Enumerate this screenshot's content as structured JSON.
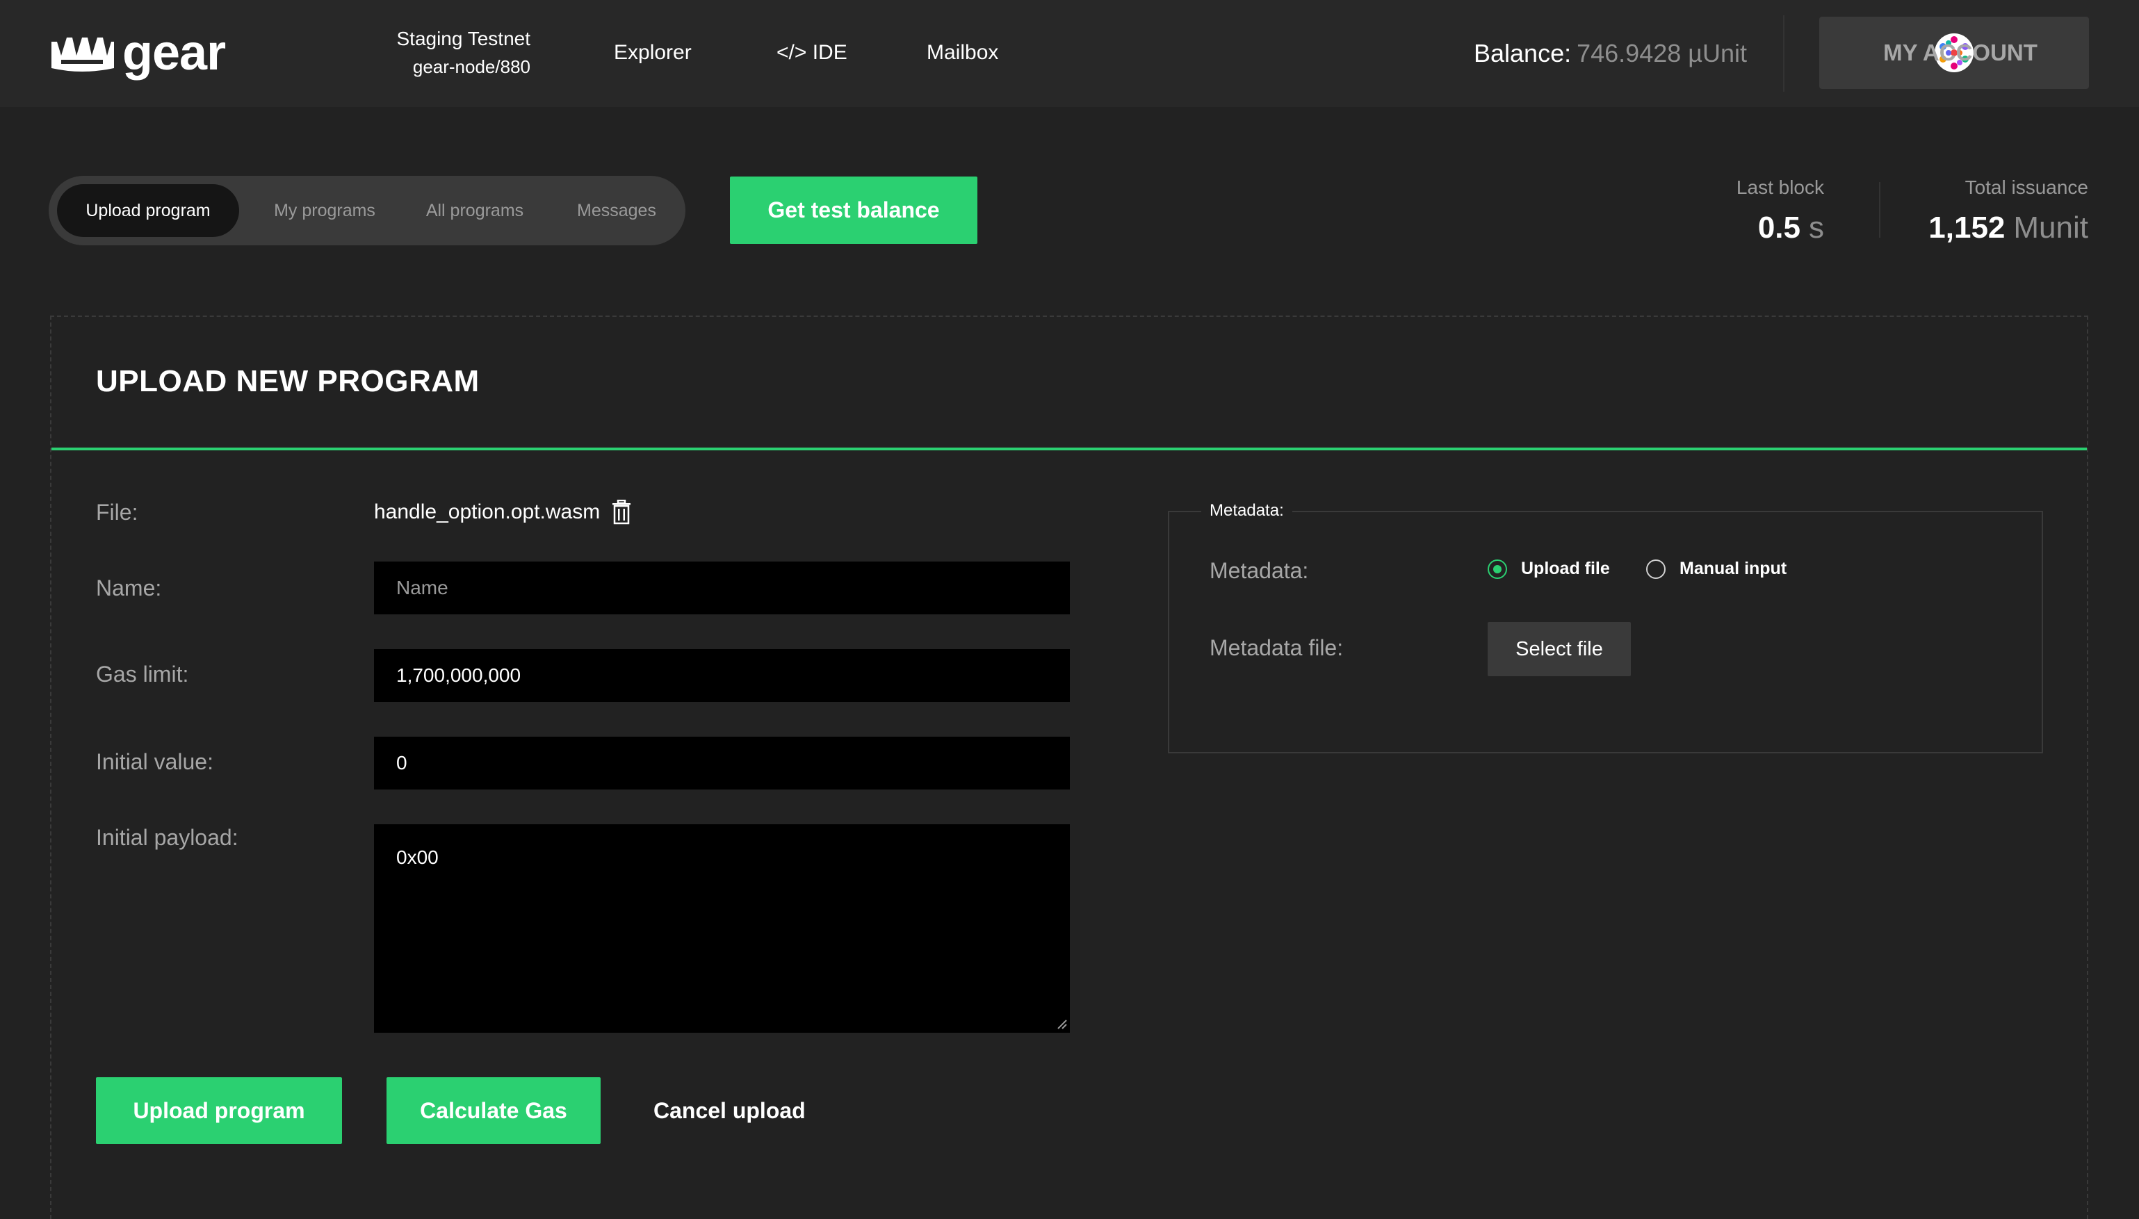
{
  "header": {
    "logo_text": "gear",
    "network": {
      "name": "Staging Testnet",
      "node": "gear-node/880"
    },
    "nav": [
      {
        "label": "Explorer"
      },
      {
        "label": "</> IDE"
      },
      {
        "label": "Mailbox"
      }
    ],
    "balance": {
      "label": "Balance:",
      "value": "746.9428 µUnit"
    },
    "account": {
      "label": "MY ACCOUNT"
    }
  },
  "tabs": [
    {
      "label": "Upload program",
      "active": true
    },
    {
      "label": "My programs",
      "active": false
    },
    {
      "label": "All programs",
      "active": false
    },
    {
      "label": "Messages",
      "active": false
    }
  ],
  "test_balance_button": "Get test balance",
  "stats": {
    "last_block": {
      "label": "Last block",
      "value": "0.5",
      "unit": "s"
    },
    "total_issuance": {
      "label": "Total issuance",
      "value": "1,152",
      "unit": "Munit"
    }
  },
  "upload": {
    "title": "UPLOAD NEW PROGRAM",
    "file": {
      "label": "File:",
      "value": "handle_option.opt.wasm"
    },
    "name": {
      "label": "Name:",
      "placeholder": "Name",
      "value": ""
    },
    "gas_limit": {
      "label": "Gas limit:",
      "value": "1,700,000,000"
    },
    "initial_value": {
      "label": "Initial value:",
      "value": "0"
    },
    "initial_payload": {
      "label": "Initial payload:",
      "value": "0x00"
    },
    "buttons": {
      "upload": "Upload program",
      "calculate_gas": "Calculate Gas",
      "cancel": "Cancel upload"
    },
    "metadata": {
      "legend": "Metadata:",
      "label": "Metadata:",
      "options": [
        {
          "label": "Upload file",
          "checked": true
        },
        {
          "label": "Manual input",
          "checked": false
        }
      ],
      "file_label": "Metadata file:",
      "select_button": "Select file"
    }
  },
  "colors": {
    "accent": "#2bd071",
    "background": "#222222",
    "header": "#282828",
    "input_bg": "#000000",
    "muted": "#a7a7a7"
  }
}
